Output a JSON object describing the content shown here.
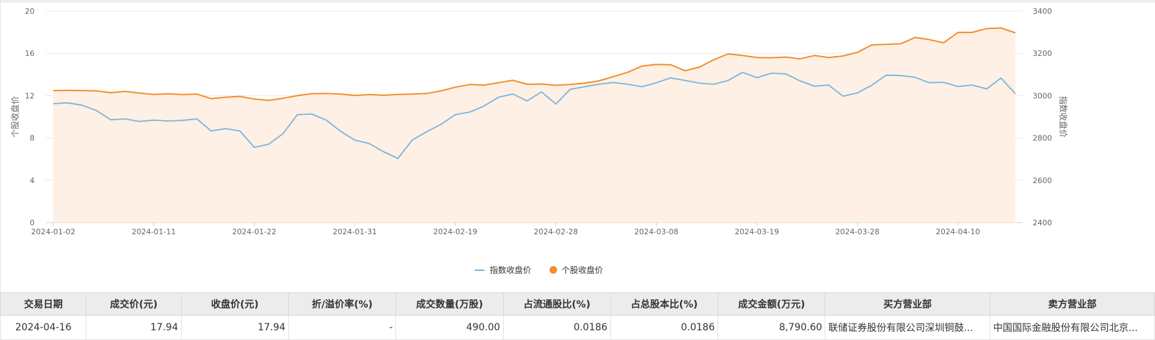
{
  "chart_data": {
    "type": "line",
    "title": "",
    "left_axis": {
      "label": "个股收盘价",
      "range": [
        0,
        20
      ],
      "ticks": [
        "0",
        "4",
        "8",
        "12",
        "16",
        "20"
      ]
    },
    "right_axis": {
      "label": "指数收盘价",
      "range": [
        2400,
        3400
      ],
      "ticks": [
        "2400",
        "2600",
        "2800",
        "3000",
        "3200",
        "3400"
      ]
    },
    "x_tick_labels": [
      "2024-01-02",
      "2024-01-11",
      "2024-01-22",
      "2024-01-31",
      "2024-02-19",
      "2024-02-28",
      "2024-03-08",
      "2024-03-19",
      "2024-03-28",
      "2024-04-10"
    ],
    "x_tick_indices": [
      0,
      7,
      14,
      21,
      28,
      35,
      42,
      49,
      56,
      63
    ],
    "grid": true,
    "legend_position": "bottom",
    "series": [
      {
        "name": "指数收盘价",
        "axis": "right",
        "color": "#7ab3de",
        "values": [
          2962,
          2966,
          2955,
          2930,
          2886,
          2890,
          2878,
          2884,
          2880,
          2883,
          2890,
          2833,
          2844,
          2833,
          2756,
          2770,
          2820,
          2910,
          2913,
          2885,
          2832,
          2790,
          2774,
          2735,
          2703,
          2790,
          2829,
          2864,
          2910,
          2922,
          2951,
          2992,
          3008,
          2975,
          3018,
          2960,
          3030,
          3042,
          3054,
          3062,
          3054,
          3042,
          3061,
          3084,
          3072,
          3059,
          3054,
          3072,
          3110,
          3085,
          3106,
          3103,
          3070,
          3045,
          3050,
          2997,
          3013,
          3049,
          3097,
          3095,
          3087,
          3061,
          3063,
          3043,
          3050,
          3032,
          3083,
          3009
        ]
      },
      {
        "name": "个股收盘价",
        "axis": "left",
        "color": "#f28e2c",
        "fill": "#fef0e4",
        "values": [
          12.48,
          12.5,
          12.48,
          12.45,
          12.28,
          12.4,
          12.25,
          12.12,
          12.18,
          12.1,
          12.15,
          11.72,
          11.85,
          11.93,
          11.68,
          11.55,
          11.75,
          12.0,
          12.18,
          12.2,
          12.15,
          12.02,
          12.1,
          12.03,
          12.12,
          12.15,
          12.2,
          12.45,
          12.8,
          13.05,
          13.0,
          13.22,
          13.45,
          13.08,
          13.1,
          12.98,
          13.05,
          13.18,
          13.4,
          13.8,
          14.2,
          14.8,
          14.95,
          14.92,
          14.35,
          14.7,
          15.4,
          15.95,
          15.8,
          15.6,
          15.58,
          15.65,
          15.48,
          15.8,
          15.6,
          15.75,
          16.1,
          16.8,
          16.85,
          16.9,
          17.5,
          17.3,
          17.0,
          17.98,
          17.98,
          18.35,
          18.4,
          17.94
        ]
      }
    ]
  },
  "table": {
    "headers": [
      "交易日期",
      "成交价(元)",
      "收盘价(元)",
      "折/溢价率(%)",
      "成交数量(万股)",
      "占流通股比(%)",
      "占总股本比(%)",
      "成交金额(万元)",
      "买方营业部",
      "卖方营业部"
    ],
    "rows": [
      [
        "2024-04-16",
        "17.94",
        "17.94",
        "-",
        "490.00",
        "0.0186",
        "0.0186",
        "8,790.60",
        "联储证券股份有限公司深圳铜鼓...",
        "中国国际金融股份有限公司北京..."
      ]
    ]
  }
}
